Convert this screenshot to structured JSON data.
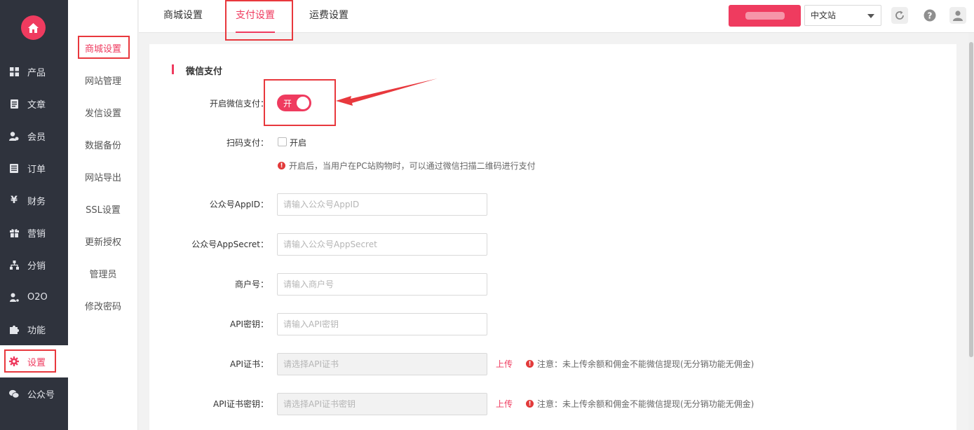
{
  "nav": {
    "items": [
      {
        "label": "产品",
        "icon": "grid-icon"
      },
      {
        "label": "文章",
        "icon": "document-icon"
      },
      {
        "label": "会员",
        "icon": "member-icon"
      },
      {
        "label": "订单",
        "icon": "order-icon"
      },
      {
        "label": "财务",
        "icon": "yen-icon"
      },
      {
        "label": "营销",
        "icon": "gift-icon"
      },
      {
        "label": "分销",
        "icon": "sitemap-icon"
      },
      {
        "label": "O2O",
        "icon": "o2o-icon"
      },
      {
        "label": "功能",
        "icon": "puzzle-icon"
      },
      {
        "label": "设置",
        "icon": "gear-icon"
      },
      {
        "label": "公众号",
        "icon": "wechat-icon"
      }
    ]
  },
  "subnav": {
    "items": [
      "商城设置",
      "网站管理",
      "发信设置",
      "数据备份",
      "网站导出",
      "SSL设置",
      "更新授权",
      "管理员",
      "修改密码"
    ]
  },
  "tabs": [
    "商城设置",
    "支付设置",
    "运费设置"
  ],
  "header": {
    "lang_selected": "中文站"
  },
  "form": {
    "section_title": "微信支付",
    "enable_label": "开启微信支付：",
    "toggle_text": "开",
    "scan_label": "扫码支付：",
    "scan_checkbox": "开启",
    "scan_hint": "开启后，当用户在PC站购物时，可以通过微信扫描二维码进行支付",
    "appid_label": "公众号AppID：",
    "appid_placeholder": "请输入公众号AppID",
    "secret_label": "公众号AppSecret：",
    "secret_placeholder": "请输入公众号AppSecret",
    "mch_label": "商户号：",
    "mch_placeholder": "请输入商户号",
    "apikey_label": "API密钥：",
    "apikey_placeholder": "请输入API密钥",
    "cert_label": "API证书：",
    "cert_placeholder": "请选择API证书",
    "certkey_label": "API证书密钥：",
    "certkey_placeholder": "请选择API证书密钥",
    "upload_label": "上传",
    "note": "注意：未上传余额和佣金不能微信提现(无分销功能无佣金)"
  },
  "colors": {
    "accent": "#ef3b5f",
    "sidebar": "#2f333d",
    "annotation": "#e8383d"
  }
}
